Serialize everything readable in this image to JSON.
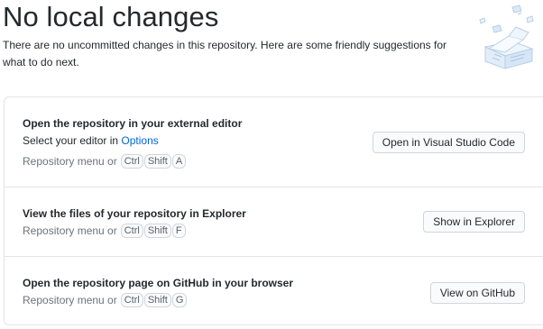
{
  "header": {
    "title": "No local changes",
    "subtitle": "There are no uncommitted changes in this repository. Here are some friendly suggestions for what to do next."
  },
  "suggestions": [
    {
      "title": "Open the repository in your external editor",
      "desc_prefix": "Select your editor in ",
      "desc_link": "Options",
      "hint_text": "Repository menu or",
      "keys": [
        "Ctrl",
        "Shift",
        "A"
      ],
      "button_label": "Open in Visual Studio Code"
    },
    {
      "title": "View the files of your repository in Explorer",
      "hint_text": "Repository menu or",
      "keys": [
        "Ctrl",
        "Shift",
        "F"
      ],
      "button_label": "Show in Explorer"
    },
    {
      "title": "Open the repository page on GitHub in your browser",
      "hint_text": "Repository menu or",
      "keys": [
        "Ctrl",
        "Shift",
        "G"
      ],
      "button_label": "View on GitHub"
    }
  ],
  "illustration": {
    "icon": "empty-state-paper-stack-illustration"
  },
  "colors": {
    "link": "#0366d6",
    "border": "#e1e4e8",
    "muted": "#6a737d"
  }
}
